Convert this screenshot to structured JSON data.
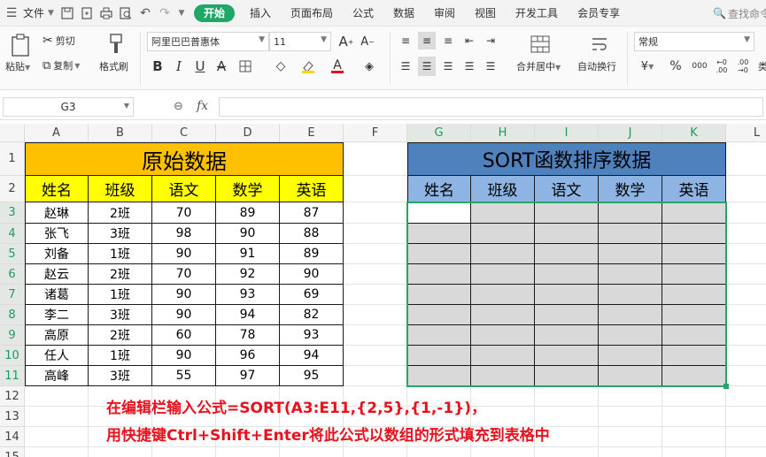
{
  "menubar": {
    "file_label": "文件",
    "tabs": [
      {
        "label": "开始",
        "active": true
      },
      {
        "label": "插入"
      },
      {
        "label": "页面布局"
      },
      {
        "label": "公式"
      },
      {
        "label": "数据"
      },
      {
        "label": "审阅"
      },
      {
        "label": "视图"
      },
      {
        "label": "开发工具"
      },
      {
        "label": "会员专享"
      }
    ],
    "search_placeholder": "查找命令"
  },
  "ribbon": {
    "paste_label": "粘贴",
    "cut_label": "剪切",
    "copy_label": "复制",
    "format_painter_label": "格式刷",
    "font_name": "阿里巴巴普惠体",
    "font_size": "11",
    "merge_label": "合并居中",
    "wrap_label": "自动换行",
    "number_format": "常规",
    "currency_symbol": "¥",
    "percent_symbol": "%",
    "thousands_symbol": "000",
    "truncated_label": "类"
  },
  "formulabar": {
    "cell_ref": "G3",
    "fx_label": "fx",
    "formula": ""
  },
  "grid": {
    "columns": [
      "A",
      "B",
      "C",
      "D",
      "E",
      "F",
      "G",
      "H",
      "I",
      "J",
      "K",
      "L"
    ],
    "rows": [
      "1",
      "2",
      "3",
      "4",
      "5",
      "6",
      "7",
      "8",
      "9",
      "10",
      "11",
      "12",
      "13",
      "14",
      "15"
    ]
  },
  "source_table": {
    "title": "原始数据",
    "headers": [
      "姓名",
      "班级",
      "语文",
      "数学",
      "英语"
    ],
    "rows": [
      [
        "赵琳",
        "2班",
        "70",
        "89",
        "87"
      ],
      [
        "张飞",
        "3班",
        "98",
        "90",
        "88"
      ],
      [
        "刘备",
        "1班",
        "90",
        "91",
        "89"
      ],
      [
        "赵云",
        "2班",
        "70",
        "92",
        "90"
      ],
      [
        "诸葛",
        "1班",
        "90",
        "93",
        "69"
      ],
      [
        "李二",
        "3班",
        "90",
        "94",
        "82"
      ],
      [
        "高原",
        "2班",
        "60",
        "78",
        "93"
      ],
      [
        "任人",
        "1班",
        "90",
        "96",
        "94"
      ],
      [
        "高峰",
        "3班",
        "55",
        "97",
        "95"
      ]
    ]
  },
  "sorted_table": {
    "title": "SORT函数排序数据",
    "headers": [
      "姓名",
      "班级",
      "语文",
      "数学",
      "英语"
    ]
  },
  "instructions": {
    "line1": "在编辑栏输入公式=SORT(A3:E11,{2,5},{1,-1})，",
    "line2": "用快捷键Ctrl+Shift+Enter将此公式以数组的形式填充到表格中"
  },
  "colors": {
    "source_title_bg": "#ffc000",
    "source_header_bg": "#ffff00",
    "sorted_title_bg": "#4f81bd",
    "sorted_header_bg": "#8db4e2",
    "selection_fill": "#d9d9d9",
    "selection_border": "#2aa36a",
    "note_text": "#e8121e",
    "active_tab": "#1fa765"
  }
}
